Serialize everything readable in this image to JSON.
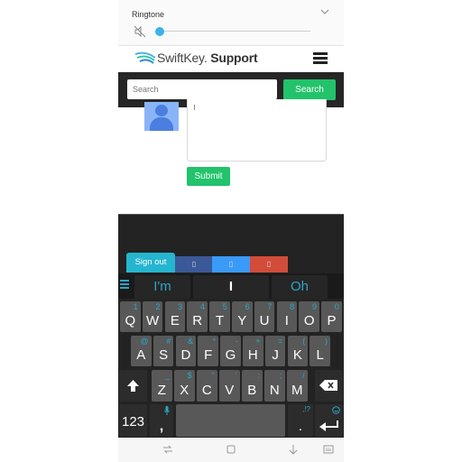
{
  "volume_panel": {
    "title": "Ringtone",
    "level": 0.0,
    "icons": [
      "mute-speaker-icon",
      "chevron-down-icon"
    ]
  },
  "site": {
    "logo_text": "SwiftKey",
    "logo_suffix": "Support",
    "search": {
      "placeholder": "Search",
      "button_label": "Search"
    },
    "submit_label": "Submit"
  },
  "keyboard": {
    "tabs": [
      {
        "label": "Sign out"
      },
      {
        "label": "▯"
      },
      {
        "label": "▯"
      },
      {
        "label": "▯"
      }
    ],
    "predictions": [
      "I'm",
      "I",
      "Oh"
    ],
    "row1": [
      {
        "key": "Q",
        "hint": "1"
      },
      {
        "key": "W",
        "hint": "2"
      },
      {
        "key": "E",
        "hint": "3"
      },
      {
        "key": "R",
        "hint": "4"
      },
      {
        "key": "T",
        "hint": "5"
      },
      {
        "key": "Y",
        "hint": "6"
      },
      {
        "key": "U",
        "hint": "7"
      },
      {
        "key": "I",
        "hint": "8"
      },
      {
        "key": "O",
        "hint": "9"
      },
      {
        "key": "P",
        "hint": "0"
      }
    ],
    "row2": [
      {
        "key": "A",
        "hint": "@"
      },
      {
        "key": "S",
        "hint": "#"
      },
      {
        "key": "D",
        "hint": "&"
      },
      {
        "key": "F",
        "hint": "*"
      },
      {
        "key": "G",
        "hint": "-"
      },
      {
        "key": "H",
        "hint": "+"
      },
      {
        "key": "J",
        "hint": "="
      },
      {
        "key": "K",
        "hint": "("
      },
      {
        "key": "L",
        "hint": ")"
      }
    ],
    "row3": [
      {
        "key": "Z",
        "hint": "_"
      },
      {
        "key": "X",
        "hint": "$"
      },
      {
        "key": "C",
        "hint": "\""
      },
      {
        "key": "V",
        "hint": "'"
      },
      {
        "key": "B",
        "hint": ":"
      },
      {
        "key": "N",
        "hint": ";"
      },
      {
        "key": "M",
        "hint": "/"
      }
    ],
    "numbers_label": "123",
    "comma": ",",
    "period": ".",
    "period_hint": ",!?"
  },
  "accent_color": "#22c36b",
  "keyboard_accent": "#2aa6c8"
}
